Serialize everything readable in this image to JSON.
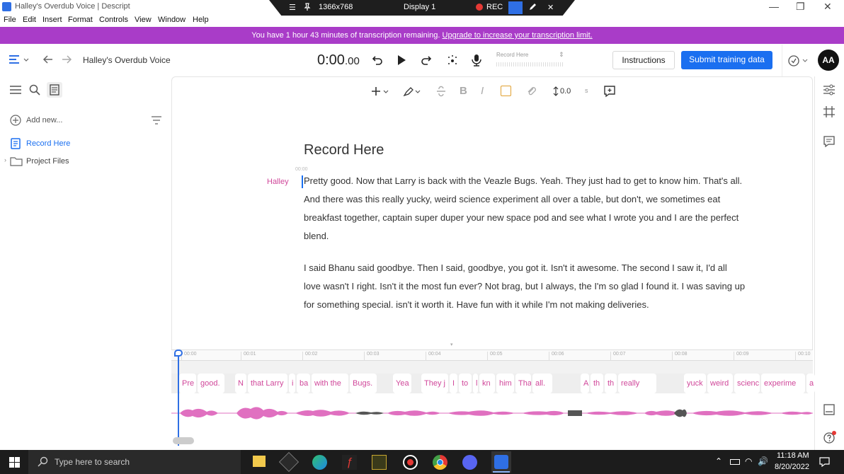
{
  "window": {
    "title": "Halley's Overdub Voice | Descript",
    "minimize": "—",
    "restore": "❐",
    "close": "✕"
  },
  "remote_toolbar": {
    "menu_icon": "☰",
    "pin_icon": "📌",
    "resolution": "1366x768",
    "display": "Display 1",
    "rec": "REC"
  },
  "menu": [
    "File",
    "Edit",
    "Insert",
    "Format",
    "Controls",
    "View",
    "Window",
    "Help"
  ],
  "banner": {
    "text": "You have 1 hour 43 minutes of transcription remaining.",
    "link": "Upgrade to increase your transcription limit."
  },
  "toolbar": {
    "project_name": "Halley's Overdub Voice",
    "time_main": "0:00",
    "time_frac": ".00",
    "track_label": "Record Here",
    "instructions_label": "Instructions",
    "submit_label": "Submit training data",
    "avatar": "AA"
  },
  "sidebar": {
    "add_new": "Add new...",
    "items": [
      {
        "label": "Record Here",
        "active": true
      },
      {
        "label": "Project Files",
        "active": false
      }
    ]
  },
  "format_bar": {
    "gap_value": "0.0",
    "speed": "s"
  },
  "document": {
    "title": "Record Here",
    "timestamp": "00:00",
    "speaker": "Halley",
    "paragraphs": [
      "Pretty good. Now that Larry is back with the Veazle Bugs. Yeah. They just had to get to know him. That's all. And there was this really yucky, weird science experiment all over a table, but don't, we sometimes eat breakfast together, captain super duper your new space pod and see what I wrote you and I are the perfect blend.",
      "I said Bhanu said goodbye. Then I said, goodbye, you got it. Isn't it awesome. The second I saw it, I'd all love wasn't I right. Isn't it the most fun ever? Not brag, but I always, the I'm so glad I found it. I was saving up for something special.  isn't it worth it. Have fun with it while I'm not making deliveries."
    ]
  },
  "timeline": {
    "ticks": [
      "00:00",
      "00:01",
      "00:02",
      "00:03",
      "00:04",
      "00:05",
      "00:06",
      "00:07",
      "00:08",
      "00:09",
      "00:10"
    ],
    "words": [
      "Pre",
      "good.",
      "N",
      "that Larry",
      "i",
      "ba",
      "with the",
      "Bugs.",
      "Yea",
      "They j",
      "I",
      "to",
      "l",
      "kn",
      "him",
      "Tha",
      "all.",
      "A",
      "th",
      "th",
      "really",
      "yuck",
      "weird",
      "scienc",
      "experime",
      "a"
    ]
  },
  "taskbar": {
    "search_placeholder": "Type here to search",
    "time": "11:18 AM",
    "date": "8/20/2022"
  },
  "colors": {
    "accent": "#1a6ff0",
    "banner": "#a93cc8",
    "speaker": "#d0479a",
    "waveform": "#e070c0"
  }
}
